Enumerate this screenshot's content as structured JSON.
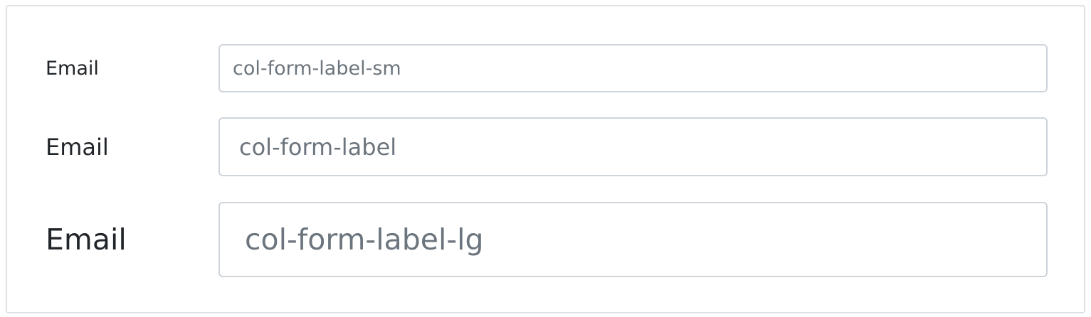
{
  "form": {
    "rows": [
      {
        "label": "Email",
        "placeholder": "col-form-label-sm",
        "value": ""
      },
      {
        "label": "Email",
        "placeholder": "col-form-label",
        "value": ""
      },
      {
        "label": "Email",
        "placeholder": "col-form-label-lg",
        "value": ""
      }
    ]
  },
  "colors": {
    "text": "#212529",
    "placeholder": "#6c757d",
    "input_border": "#ced4da",
    "panel_border": "#dee2e6",
    "background": "#ffffff"
  }
}
